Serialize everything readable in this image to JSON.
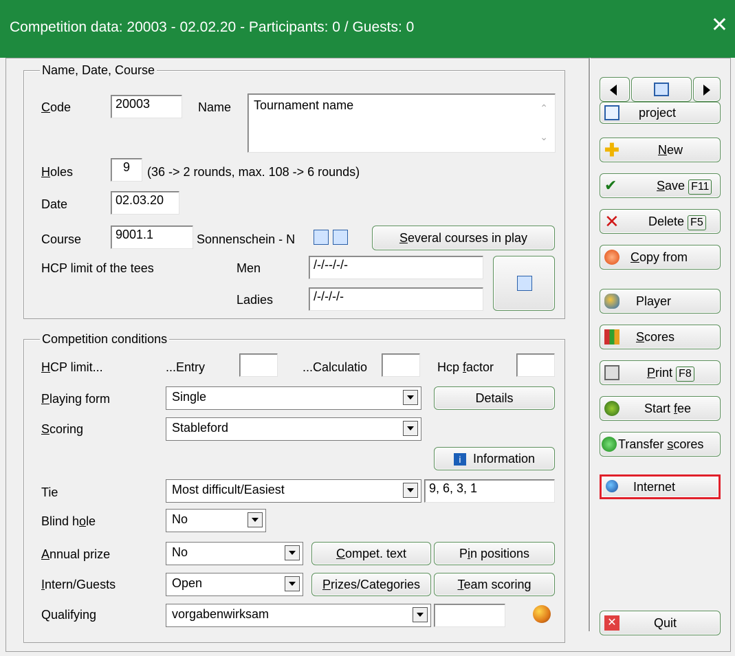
{
  "window": {
    "title": "Competition data: 20003 - 02.02.20 - Participants: 0 / Guests: 0",
    "close": "✕"
  },
  "group1": {
    "title": "Name, Date, Course",
    "code_label_u": "C",
    "code_label_rest": "ode",
    "code_value": "20003",
    "name_label": "Name",
    "name_value": "Tournament name",
    "holes_label_u": "H",
    "holes_label_rest": "oles",
    "holes_value": "9",
    "holes_note": "(36 -> 2 rounds, max. 108 -> 6 rounds)",
    "date_label": "Date",
    "date_value": "02.03.20",
    "course_label": "Course",
    "course_value": "9001.1",
    "course_name": "Sonnenschein - N",
    "several_u": "S",
    "several_rest": "everal courses in play",
    "hcp_tees_label": "HCP limit of the tees",
    "men_label": "Men",
    "men_value": "/-/--/-/-",
    "ladies_label": "Ladies",
    "ladies_value": "/-/-/-/-"
  },
  "group2": {
    "title": "Competition conditions",
    "hcp_limit_u": "H",
    "hcp_limit_rest": "CP limit...",
    "entry_label": "...Entry",
    "entry_value": "",
    "calc_label": "...Calculatio",
    "calc_value": "",
    "hcp_factor_pre": "Hcp ",
    "hcp_factor_u": "f",
    "hcp_factor_rest": "actor",
    "hcp_factor_value": "",
    "playing_form_u": "P",
    "playing_form_rest": "laying form",
    "playing_form_value": "Single",
    "details_btn": "Details",
    "scoring_u": "S",
    "scoring_rest": "coring",
    "scoring_value": "Stableford",
    "information_btn": "Information",
    "tie_label": "Tie",
    "tie_value": "Most difficult/Easiest",
    "tie_holes": "9, 6, 3, 1",
    "blind_pre": "Blind h",
    "blind_u": "o",
    "blind_rest": "le",
    "blind_value": "No",
    "annual_u": "A",
    "annual_rest": "nnual prize",
    "annual_value": "No",
    "compet_u": "C",
    "compet_rest": "ompet. text",
    "pin_pre": "P",
    "pin_u": "i",
    "pin_rest": "n positions",
    "intern_u": "I",
    "intern_rest": "ntern/Guests",
    "intern_value": "Open",
    "prizes_u": "P",
    "prizes_rest": "rizes/Categories",
    "team_u": "T",
    "team_rest": "eam scoring",
    "qualifying_label": "Qualifying",
    "qualifying_value": "vorgabenwirksam",
    "qualifying_extra": ""
  },
  "sidebar": {
    "project": "project",
    "new_u": "N",
    "new_rest": "ew",
    "save_u": "S",
    "save_rest": "ave",
    "save_key": "F11",
    "delete_label": "Delete",
    "delete_key": "F5",
    "copy_u": "C",
    "copy_rest": "opy from",
    "player": "Player",
    "scores_u": "S",
    "scores_rest": "cores",
    "print_u": "P",
    "print_rest": "rint",
    "print_key": "F8",
    "start_pre": "Start ",
    "start_u": "f",
    "start_rest": "ee",
    "transfer_pre": "Transfer ",
    "transfer_u": "s",
    "transfer_rest": "cores",
    "internet": "Internet",
    "quit": "Quit"
  },
  "colors": {
    "titlebar": "#1e8a3e",
    "highlight": "#e0202a",
    "accent_border": "#5b8f5b"
  }
}
